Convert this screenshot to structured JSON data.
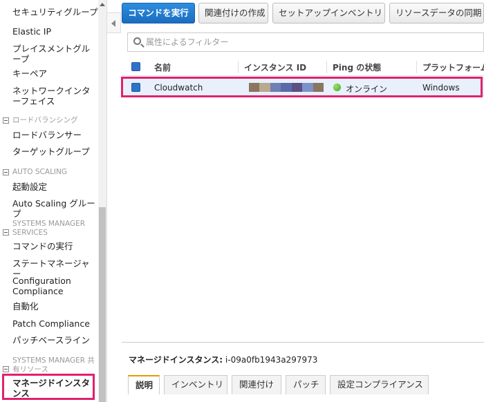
{
  "sidebar": {
    "items": [
      {
        "label": "セキュリティグループ"
      },
      {
        "label": "Elastic IP"
      },
      {
        "label": "プレイスメントグループ"
      },
      {
        "label": "キーペア"
      },
      {
        "label": "ネットワークインターフェイス"
      }
    ],
    "sections": [
      {
        "title": "ロードバランシング",
        "items": [
          "ロードバランサー",
          "ターゲットグループ"
        ]
      },
      {
        "title": "AUTO SCALING",
        "items": [
          "起動設定",
          "Auto Scaling グループ"
        ]
      },
      {
        "title": "SYSTEMS MANAGER SERVICES",
        "items": [
          "コマンドの実行",
          "ステートマネージャー",
          "Configuration Compliance",
          "自動化",
          "Patch Compliance",
          "パッチベースライン"
        ]
      },
      {
        "title": "SYSTEMS MANAGER 共有リソース",
        "items": [
          "マネージドインスタンス"
        ]
      }
    ]
  },
  "toolbar": {
    "run_command": "コマンドを実行",
    "create_association": "関連付けの作成",
    "setup_inventory": "セットアップインベントリ",
    "resource_data_sync": "リソースデータの同期"
  },
  "filter": {
    "placeholder": "属性によるフィルター"
  },
  "table": {
    "columns": [
      "名前",
      "インスタンス ID",
      "Ping の状態",
      "プラットフォーム"
    ],
    "rows": [
      {
        "name": "Cloudwatch",
        "ping_status": "オンライン",
        "platform": "Windows"
      }
    ],
    "status_online_color": "#3fa61a",
    "redacted_id_colors": [
      "#8a7560",
      "#b9a98e",
      "#6d7fb5",
      "#5a6aa8",
      "#5b4f86",
      "#7b92c9",
      "#8a7560"
    ]
  },
  "details": {
    "label": "マネージドインスタンス:",
    "instance_id": "i-09a0fb1943a297973",
    "tabs": [
      "説明",
      "インベントリ",
      "関連付け",
      "パッチ",
      "設定コンプライアンス"
    ]
  },
  "colors": {
    "primary_button": "#1a6dbf",
    "highlight_border": "#e0216e",
    "active_tab_accent": "#e69a00"
  }
}
